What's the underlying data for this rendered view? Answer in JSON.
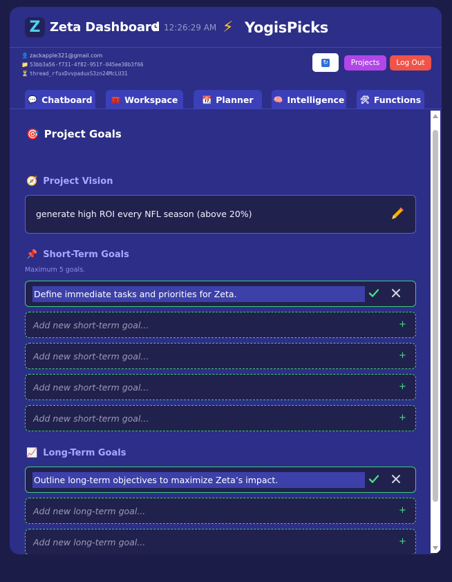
{
  "header": {
    "logo_letter": "Z",
    "app_title": "Zeta Dashboard",
    "time": "12:26:29 AM",
    "brand": "YogisPicks"
  },
  "meta": {
    "email": "zackapple321@gmail.com",
    "project_id": "53bb3a56-f731-4f82-951f-045ee30b3f66",
    "thread_id": "thread_rfuxDvvpaduxS3zn24McLU31"
  },
  "actions": {
    "projects_label": "Projects",
    "logout_label": "Log Out",
    "refresh_icon": "refresh-icon"
  },
  "tabs": [
    {
      "label": "Chatboard",
      "icon": "💬"
    },
    {
      "label": "Workspace",
      "icon": "🧰"
    },
    {
      "label": "Planner",
      "icon": "📆"
    },
    {
      "label": "Intelligence",
      "icon": "🧠"
    },
    {
      "label": "Functions",
      "icon": "🛠"
    }
  ],
  "goals": {
    "title": "Project Goals",
    "vision": {
      "heading": "Project Vision",
      "text": "generate high ROI every NFL season (above 20%)"
    },
    "short_term": {
      "heading": "Short-Term Goals",
      "hint": "Maximum 5 goals.",
      "active_goal": "Define immediate tasks and priorities for Zeta.",
      "placeholder": "Add new short-term goal..."
    },
    "long_term": {
      "heading": "Long-Term Goals",
      "active_goal": "Outline long-term objectives to maximize Zeta’s impact.",
      "placeholder": "Add new long-term goal..."
    },
    "plus": "+"
  },
  "colors": {
    "background": "#1c1c48",
    "card": "#2d2e87",
    "tab": "#3b3fb8",
    "goal_border": "#3fcf7a",
    "projects": "#b246e8",
    "logout": "#f05349"
  }
}
